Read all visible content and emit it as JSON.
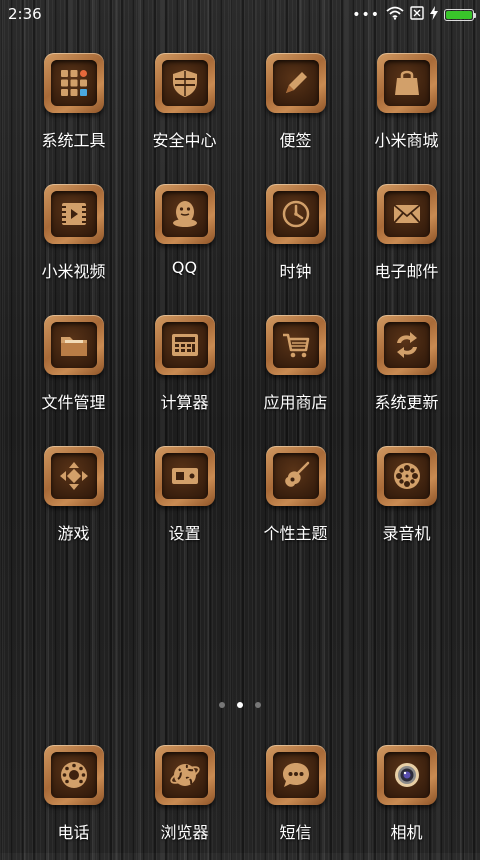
{
  "status_bar": {
    "time": "2:36",
    "battery_level": 1.0,
    "battery_color": "#39c52a",
    "icons": [
      "more-dots-icon",
      "wifi-icon",
      "no-sim-icon",
      "charging-icon",
      "battery-icon"
    ]
  },
  "apps": [
    {
      "label": "系统工具",
      "icon": "tools-folder-icon"
    },
    {
      "label": "安全中心",
      "icon": "shield-icon"
    },
    {
      "label": "便签",
      "icon": "pencil-note-icon"
    },
    {
      "label": "小米商城",
      "icon": "shopping-bag-icon"
    },
    {
      "label": "小米视频",
      "icon": "video-film-icon"
    },
    {
      "label": "QQ",
      "icon": "qq-penguin-icon"
    },
    {
      "label": "时钟",
      "icon": "clock-icon"
    },
    {
      "label": "电子邮件",
      "icon": "mail-envelope-icon"
    },
    {
      "label": "文件管理",
      "icon": "folder-icon"
    },
    {
      "label": "计算器",
      "icon": "calculator-icon"
    },
    {
      "label": "应用商店",
      "icon": "shopping-cart-icon"
    },
    {
      "label": "系统更新",
      "icon": "refresh-arrows-icon"
    },
    {
      "label": "游戏",
      "icon": "dpad-game-icon"
    },
    {
      "label": "设置",
      "icon": "settings-toggle-icon"
    },
    {
      "label": "个性主题",
      "icon": "guitar-icon"
    },
    {
      "label": "录音机",
      "icon": "film-reel-icon"
    }
  ],
  "page_indicator": {
    "count": 3,
    "active_index": 1
  },
  "dock": [
    {
      "label": "电话",
      "icon": "rotary-phone-icon"
    },
    {
      "label": "浏览器",
      "icon": "globe-browser-icon"
    },
    {
      "label": "短信",
      "icon": "chat-bubble-icon"
    },
    {
      "label": "相机",
      "icon": "camera-lens-icon"
    }
  ],
  "colors": {
    "frame_light": "#d29a62",
    "frame_dark": "#8e5428",
    "inner": "#3e220f",
    "glyph": "#d2a06a",
    "label": "#ffffff"
  }
}
